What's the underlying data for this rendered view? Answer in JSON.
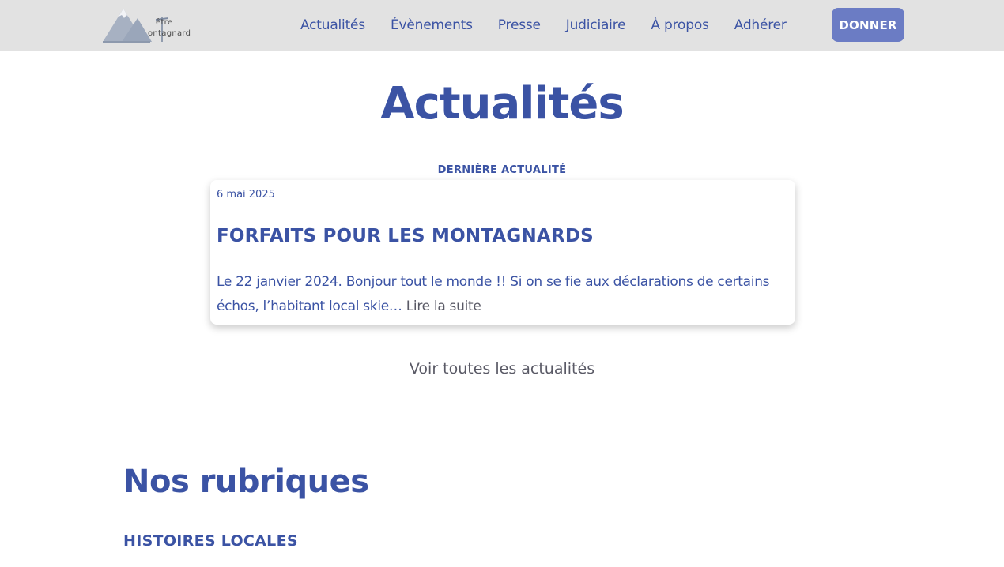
{
  "header": {
    "logo": {
      "word_top": "être",
      "word_bottom": "ontagnard"
    },
    "nav": [
      {
        "label": "Actualités"
      },
      {
        "label": "Évènements"
      },
      {
        "label": "Presse"
      },
      {
        "label": "Judiciaire"
      },
      {
        "label": "À propos"
      },
      {
        "label": "Adhérer"
      }
    ],
    "donate_label": "DONNER"
  },
  "main": {
    "title": "Actualités",
    "latest_label": "DERNIÈRE ACTUALITÉ",
    "latest_post": {
      "date": "6 mai 2025",
      "title": "FORFAITS POUR LES MONTAGNARDS",
      "excerpt": "Le 22 janvier 2024. Bonjour tout le monde !! Si on se fie aux déclarations de certains échos, l’habitant local skie…",
      "read_more": "Lire la suite"
    },
    "all_news_link": "Voir toutes les actualités",
    "sections_title": "Nos rubriques",
    "first_category": "HISTOIRES LOCALES"
  },
  "colors": {
    "brand_blue": "#3b53a4",
    "donate_bg": "#6b7cc4",
    "header_bg": "#e2e2e2",
    "muted_text": "#5a5a66"
  }
}
